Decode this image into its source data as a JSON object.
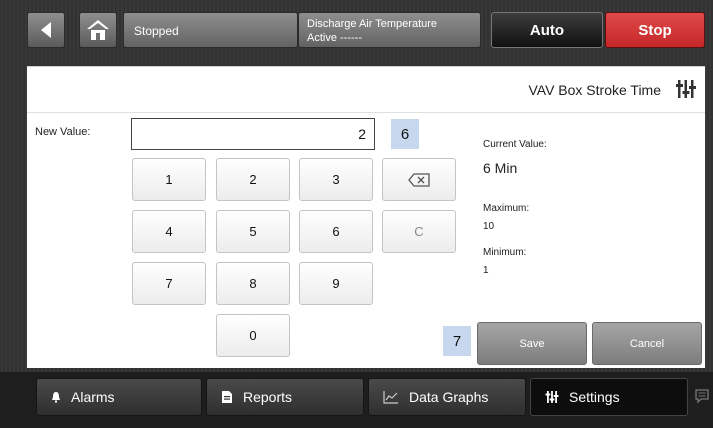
{
  "header": {
    "status": "Stopped",
    "info_line1": "Discharge Air Temperature",
    "info_line2": "Active ------",
    "auto_label": "Auto",
    "stop_label": "Stop",
    "stop_color": "#c62828"
  },
  "panel": {
    "title": "VAV Box Stroke Time",
    "new_value_label": "New Value:",
    "new_value": "2",
    "current_value_label": "Current Value:",
    "current_value": "6 Min",
    "maximum_label": "Maximum:",
    "maximum_value": "10",
    "minimum_label": "Minimum:",
    "minimum_value": "1",
    "save_label": "Save",
    "cancel_label": "Cancel",
    "backspace_icon": "backspace-icon",
    "clear_label": "C"
  },
  "keypad": {
    "k1": "1",
    "k2": "2",
    "k3": "3",
    "k4": "4",
    "k5": "5",
    "k6": "6",
    "k7": "7",
    "k8": "8",
    "k9": "9",
    "k0": "0"
  },
  "markers": {
    "m6": "6",
    "m7": "7"
  },
  "footer": {
    "alarms": "Alarms",
    "reports": "Reports",
    "data_graphs": "Data Graphs",
    "settings": "Settings"
  }
}
